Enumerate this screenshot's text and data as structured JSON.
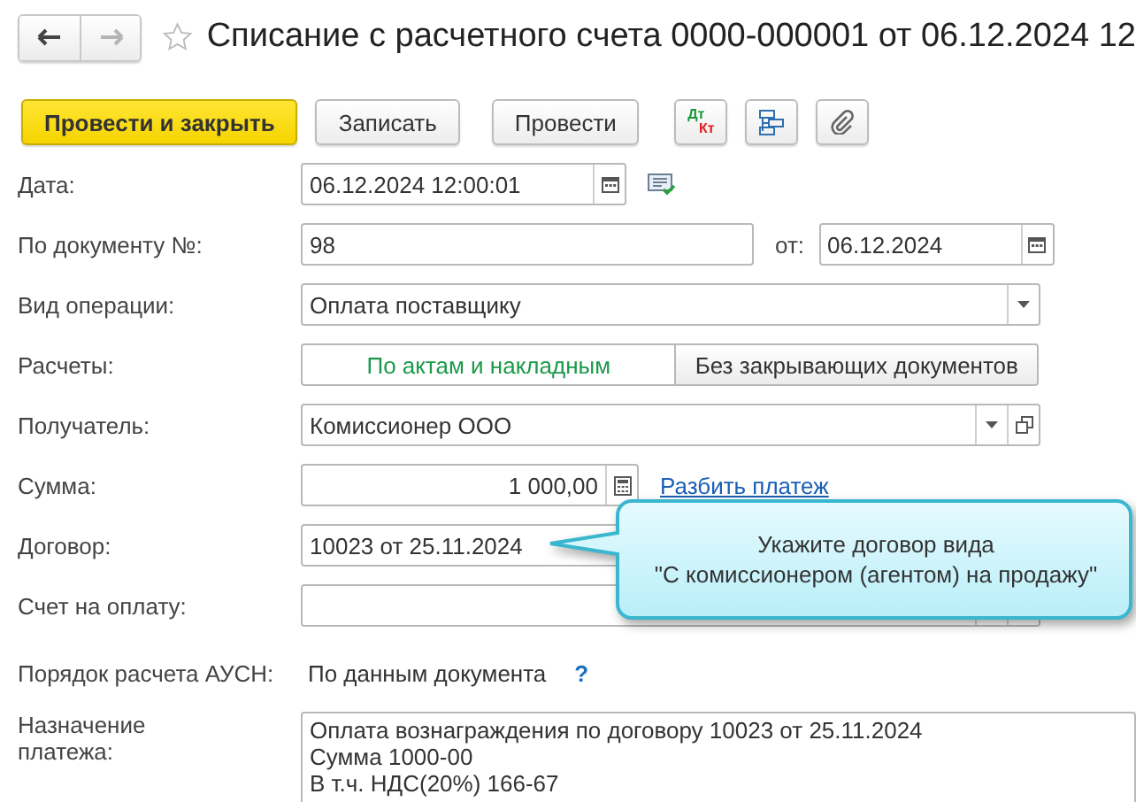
{
  "nav": [
    {
      "kind": "back",
      "disabled": false
    },
    {
      "kind": "forward",
      "disabled": true
    }
  ],
  "favorite": false,
  "title": "Списание с расчетного счета 0000-000001 от 06.12.2024 12",
  "toolbar": [
    {
      "kind": "primary",
      "label": "Провести и закрыть"
    },
    {
      "kind": "default",
      "label": "Записать"
    },
    {
      "kind": "default",
      "label": "Провести"
    },
    {
      "kind": "dtkt",
      "label": "Дт",
      "label2": "Кт"
    },
    {
      "kind": "structure"
    },
    {
      "kind": "attach"
    }
  ],
  "date": {
    "label": "Дата:",
    "value": "06.12.2024 12:00:01"
  },
  "doc_number": {
    "label": "По документу №:",
    "value": "98",
    "date_label": "от:",
    "date_value": "06.12.2024"
  },
  "operation": {
    "label": "Вид операции:",
    "value": "Оплата поставщику"
  },
  "settlements": {
    "label": "Расчеты:",
    "options": [
      {
        "label": "По актам и накладным",
        "selected": true
      },
      {
        "label": "Без закрывающих документов",
        "selected": false
      }
    ]
  },
  "recipient": {
    "label": "Получатель:",
    "value": "Комиссионер ООО"
  },
  "amount": {
    "label": "Сумма:",
    "value": "1 000,00",
    "link": "Разбить платеж"
  },
  "contract": {
    "label": "Договор:",
    "value": "10023 от 25.11.2024"
  },
  "invoice": {
    "label": "Счет на оплату:"
  },
  "ausn": {
    "label": "Порядок расчета АУСН:",
    "value": "По данным документа",
    "help": "?"
  },
  "purpose": {
    "label": "Назначение платежа:",
    "lines": [
      "Оплата вознаграждения по договору 10023 от 25.11.2024",
      "Сумма 1000-00",
      "В т.ч. НДС(20%) 166-67"
    ]
  },
  "tooltip": {
    "lines": [
      "Укажите договор вида",
      "\"С комиссионером (агентом) на продажу\""
    ]
  }
}
